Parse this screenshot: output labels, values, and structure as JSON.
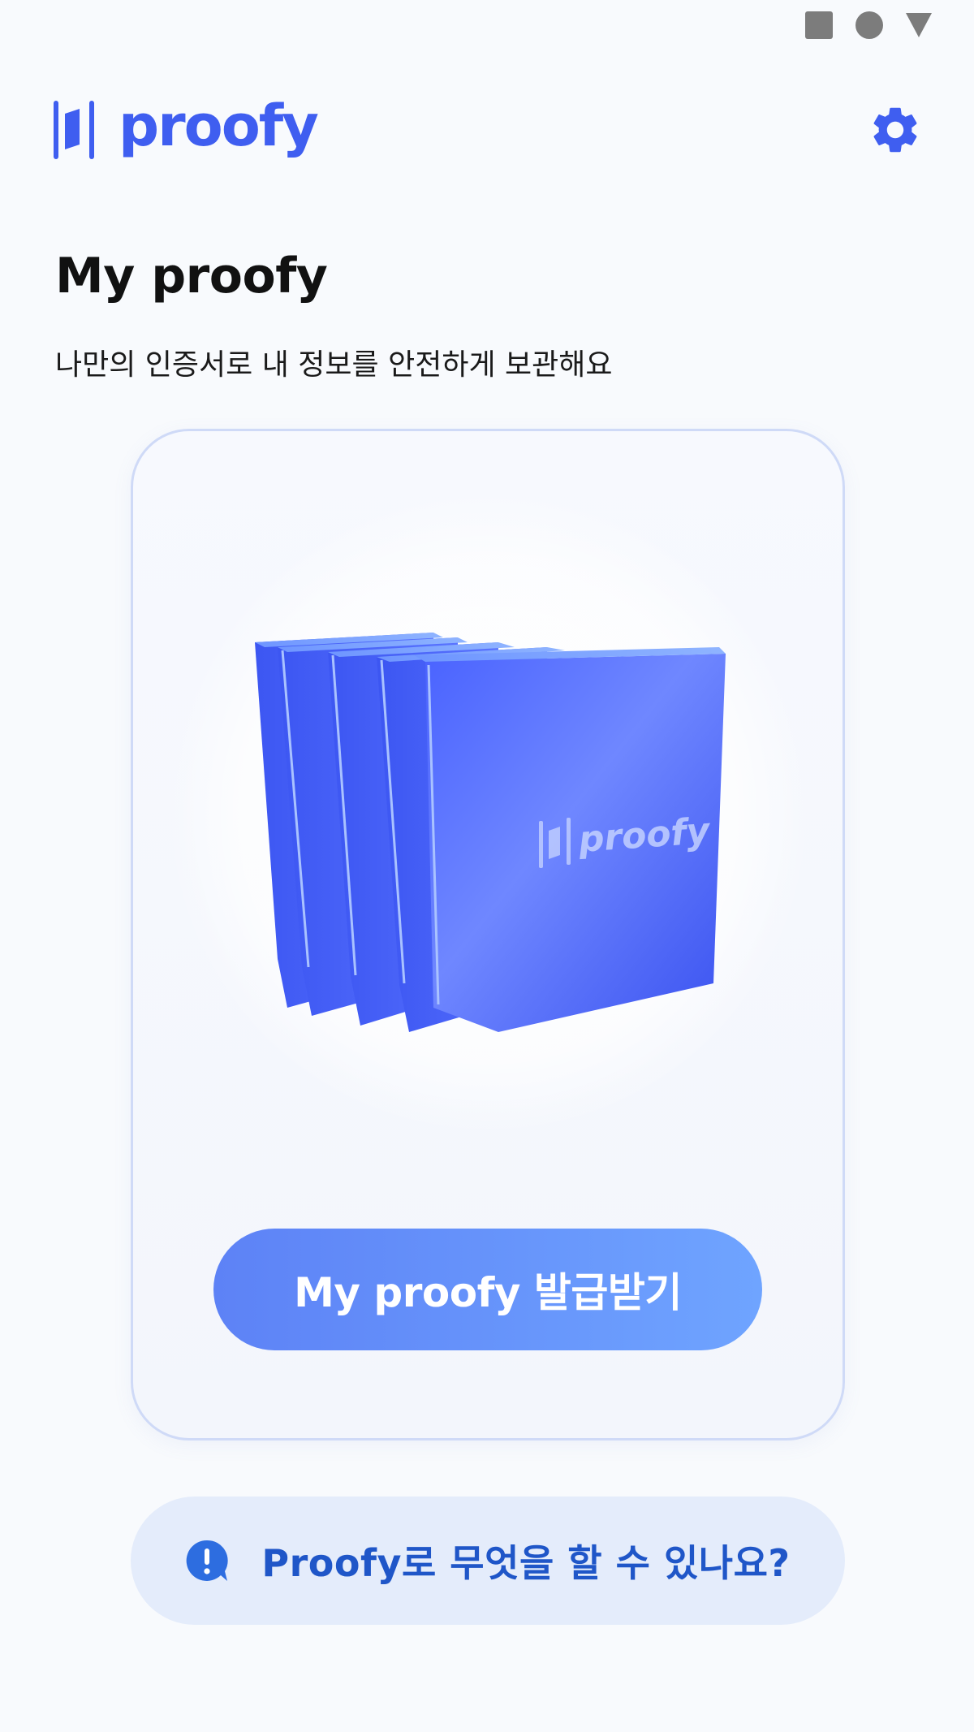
{
  "status_bar": {
    "icons": [
      "square-icon",
      "circle-icon",
      "triangle-icon"
    ]
  },
  "header": {
    "logo_text": "proofy",
    "settings_icon": "gear-icon"
  },
  "main": {
    "title": "My proofy",
    "subtitle": "나만의 인증서로 내 정보를 안전하게 보관해요",
    "card": {
      "illustration_label": "proofy",
      "issue_button_label": "My proofy 발급받기"
    },
    "help": {
      "icon": "question-bubble-icon",
      "label": "Proofy로 무엇을 할 수 있나요?"
    }
  },
  "colors": {
    "brand": "#3f5ef0",
    "button_start": "#5d82f6",
    "button_end": "#6fa4ff",
    "help_bg": "#e4ecfb",
    "help_text": "#1f56c8"
  }
}
